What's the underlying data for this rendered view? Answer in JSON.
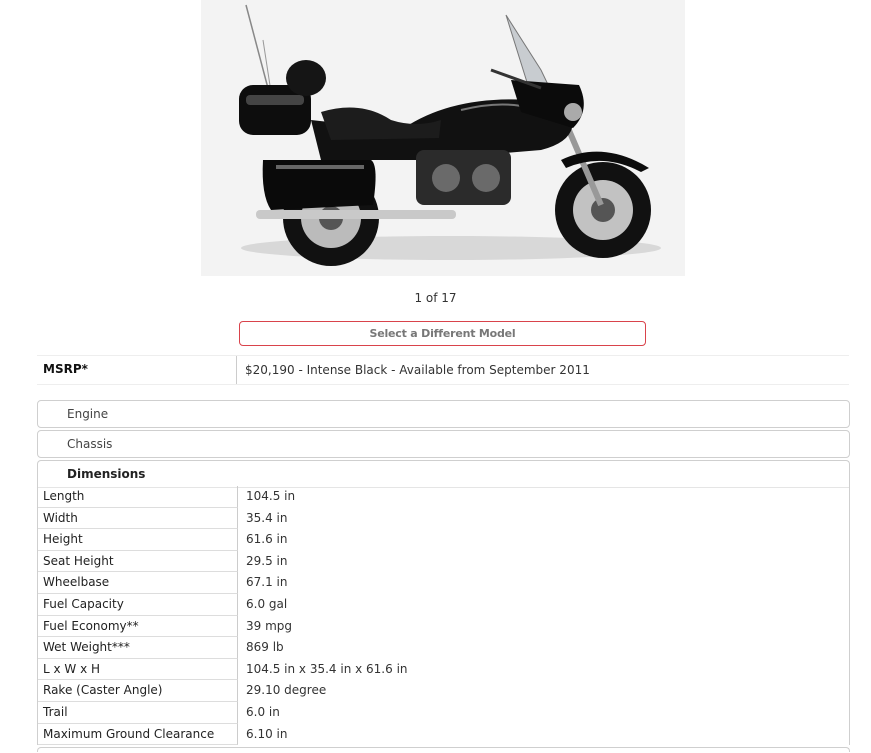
{
  "gallery": {
    "counter": "1 of 17",
    "image_subject": "motorcycle-photo"
  },
  "model_select": {
    "label": "Select a Different Model"
  },
  "msrp": {
    "label": "MSRP*",
    "value": "$20,190 - Intense Black - Available from September 2011"
  },
  "sections": [
    {
      "label": "Engine",
      "expanded": false
    },
    {
      "label": "Chassis",
      "expanded": false
    },
    {
      "label": "Dimensions",
      "expanded": true
    }
  ],
  "dimensions": [
    {
      "label": "Length",
      "value": "104.5 in"
    },
    {
      "label": "Width",
      "value": "35.4 in"
    },
    {
      "label": "Height",
      "value": "61.6 in"
    },
    {
      "label": "Seat Height",
      "value": "29.5 in"
    },
    {
      "label": "Wheelbase",
      "value": "67.1 in"
    },
    {
      "label": "Fuel Capacity",
      "value": "6.0 gal"
    },
    {
      "label": "Fuel Economy**",
      "value": "39 mpg"
    },
    {
      "label": "Wet Weight***",
      "value": "869 lb"
    },
    {
      "label": "L x W x H",
      "value": "104.5 in x 35.4 in x 61.6 in"
    },
    {
      "label": "Rake (Caster Angle)",
      "value": "29.10 degree"
    },
    {
      "label": "Trail",
      "value": "6.0 in"
    },
    {
      "label": "Maximum Ground Clearance",
      "value": "6.10 in"
    }
  ],
  "colors": {
    "accent_border": "#d9434b",
    "panel_border": "#cfcfcf"
  }
}
